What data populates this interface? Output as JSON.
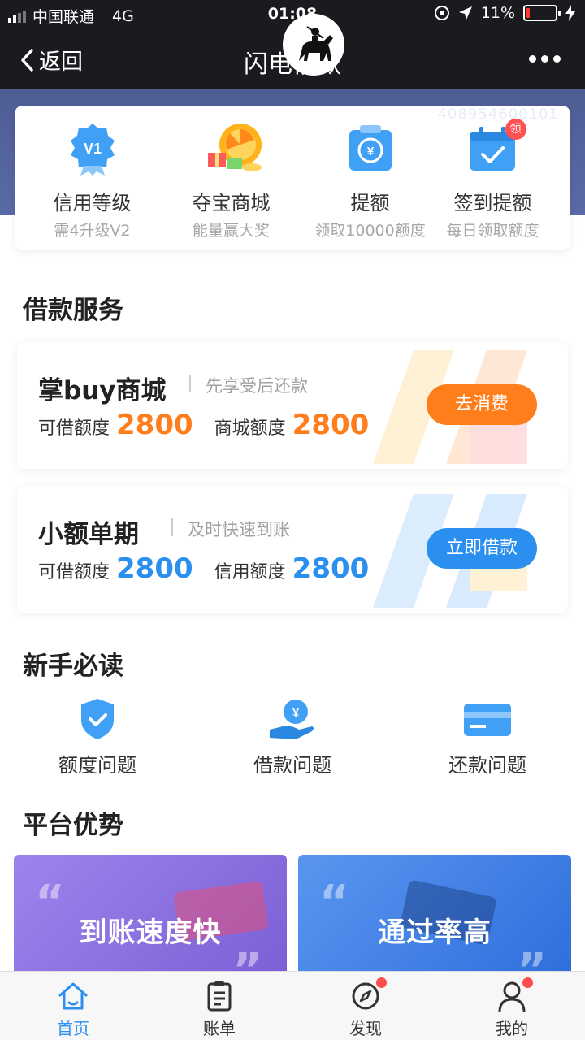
{
  "status_bar": {
    "carrier": "中国联通",
    "network": "4G",
    "time": "01:08",
    "battery": "11%",
    "battery_level": 0.11
  },
  "nav": {
    "back_label": "返回",
    "title": "闪电借款"
  },
  "top_card": {
    "watermark": "408954600101",
    "features": [
      {
        "icon": "v1-badge-icon",
        "title": "信用等级",
        "subtitle": "需4升级V2"
      },
      {
        "icon": "prize-wheel-icon",
        "title": "夺宝商城",
        "subtitle": "能量赢大奖"
      },
      {
        "icon": "quota-raise-icon",
        "title": "提额",
        "subtitle": "领取10000额度"
      },
      {
        "icon": "checkin-calendar-icon",
        "title": "签到提额",
        "subtitle": "每日领取额度",
        "badge": "领"
      }
    ]
  },
  "loan_section": {
    "title": "借款服务",
    "cards": [
      {
        "name": "掌buy商城",
        "tag": "先享受后还款",
        "label1": "可借额度",
        "value1": "2800",
        "label2": "商城额度",
        "value2": "2800",
        "button": "去消费",
        "color": "#ff7d1a"
      },
      {
        "name": "小额单期",
        "tag": "及时快速到账",
        "label1": "可借额度",
        "value1": "2800",
        "label2": "信用额度",
        "value2": "2800",
        "button": "立即借款",
        "color": "#2b8ff0"
      }
    ]
  },
  "guide_section": {
    "title": "新手必读",
    "items": [
      {
        "icon": "shield-check-icon",
        "label": "额度问题"
      },
      {
        "icon": "hand-coin-icon",
        "label": "借款问题"
      },
      {
        "icon": "credit-card-icon",
        "label": "还款问题"
      }
    ]
  },
  "advantage_section": {
    "title": "平台优势",
    "tiles": [
      {
        "text": "到账速度快",
        "color": "#8a6fe0"
      },
      {
        "text": "通过率高",
        "color": "#3d7fe0"
      }
    ]
  },
  "tab_bar": {
    "active_color": "#2b8ff0",
    "tabs": [
      {
        "icon": "home-icon",
        "label": "首页",
        "active": true
      },
      {
        "icon": "bill-icon",
        "label": "账单"
      },
      {
        "icon": "compass-icon",
        "label": "发现",
        "dot": true
      },
      {
        "icon": "user-icon",
        "label": "我的",
        "dot": true
      }
    ]
  }
}
